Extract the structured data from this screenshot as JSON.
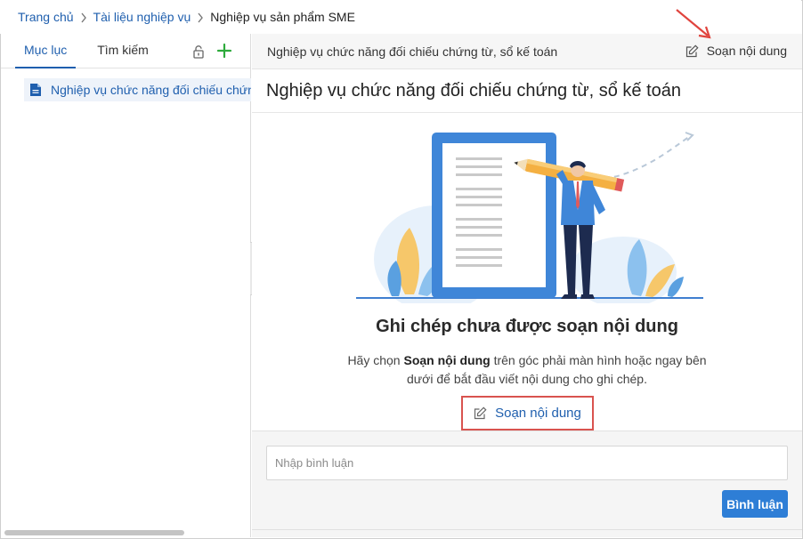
{
  "breadcrumb": {
    "items": [
      "Trang chủ",
      "Tài liệu nghiệp vụ"
    ],
    "current": "Nghiệp vụ sản phẩm SME"
  },
  "sidebar": {
    "tabs": [
      "Mục lục",
      "Tìm kiếm"
    ],
    "active_tab": "Mục lục",
    "tree_items": [
      "Nghiệp vụ chức năng đối chiếu chứng từ, sổ kế toán"
    ]
  },
  "main": {
    "header_title": "Nghiệp vụ chức năng đối chiếu chứng từ, sổ kế toán",
    "edit_label": "Soạn nội dung",
    "doc_title": "Nghiệp vụ chức năng đối chiếu chứng từ, sổ kế toán",
    "empty_title": "Ghi chép chưa được soạn nội dung",
    "empty_desc_prefix": "Hãy chọn ",
    "empty_desc_bold": "Soạn nội dung",
    "empty_desc_line1_suffix": " trên góc phải màn hình hoặc ngay bên",
    "empty_desc_line2": "dưới để bắt đầu viết nội dung cho ghi chép.",
    "edit_center_label": "Soạn nội dung"
  },
  "comment": {
    "placeholder": "Nhập bình luận",
    "button_label": "Bình luận"
  },
  "colors": {
    "link_blue": "#1f5fae",
    "add_green": "#2eaa3c",
    "button_blue": "#2e7ed6",
    "highlight_red": "#d9534f"
  },
  "icons": {
    "separator": "chevron-right-icon",
    "lock": "lock-icon",
    "add": "plus-icon",
    "document": "document-icon",
    "edit": "edit-icon",
    "collapse": "chevron-left-icon"
  }
}
